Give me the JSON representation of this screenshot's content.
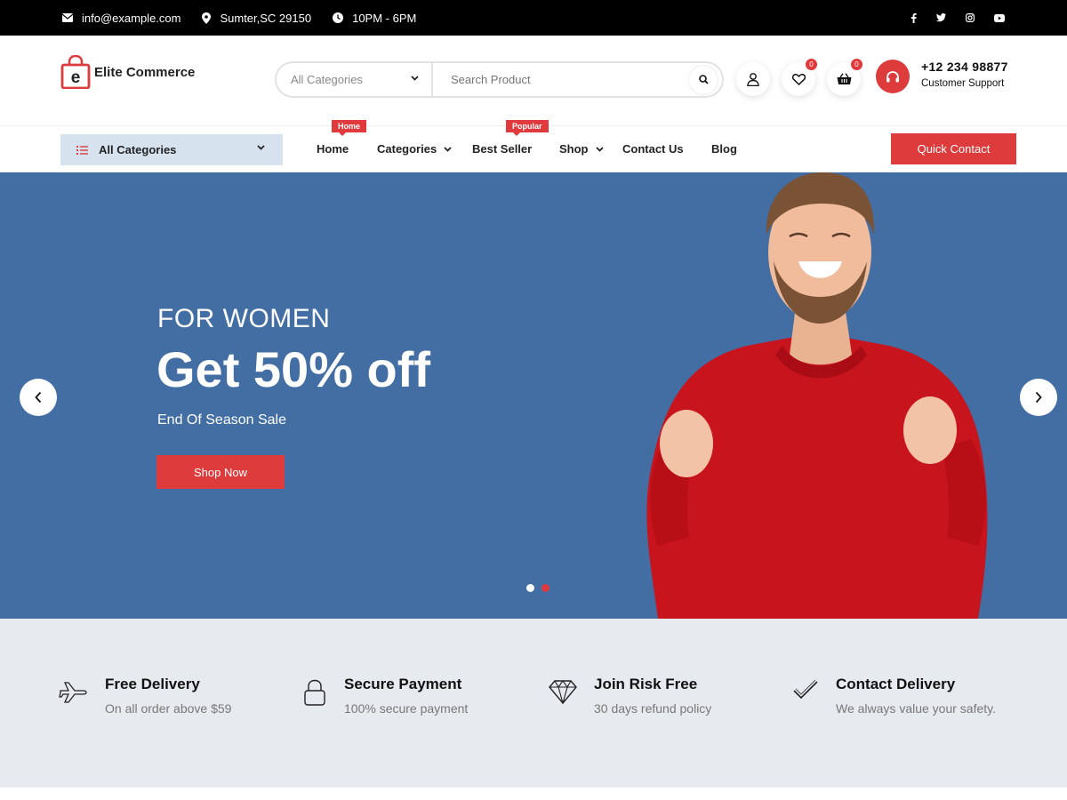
{
  "topbar": {
    "email": "info@example.com",
    "location": "Sumter,SC 29150",
    "hours": "10PM - 6PM",
    "social": [
      "facebook-icon",
      "twitter-icon",
      "instagram-icon",
      "youtube-icon"
    ]
  },
  "brand": {
    "logo_letter": "e",
    "name": "Elite Commerce",
    "accent": "#dd3b3c"
  },
  "search": {
    "category_value": "All Categories",
    "placeholder": "Search Product"
  },
  "header_icons": {
    "wishlist_count": "0",
    "cart_count": "0"
  },
  "support": {
    "phone": "+12 234 98877",
    "label": "Customer Support"
  },
  "nav": {
    "all_categories": "All Categories",
    "items": [
      {
        "label": "Home",
        "tag": "Home"
      },
      {
        "label": "Categories"
      },
      {
        "label": "Best Seller",
        "tag": "Popular"
      },
      {
        "label": "Shop"
      },
      {
        "label": "Contact Us"
      },
      {
        "label": "Blog"
      }
    ],
    "quick_contact": "Quick Contact"
  },
  "hero": {
    "subtitle": "FOR WOMEN",
    "title": "Get 50% off",
    "description": "End Of Season Sale",
    "button": "Shop Now",
    "background": "#426ea3",
    "slides": 2,
    "active_slide": 1
  },
  "features": [
    {
      "icon": "plane-icon",
      "title": "Free Delivery",
      "desc": "On all order above $59"
    },
    {
      "icon": "lock-icon",
      "title": "Secure Payment",
      "desc": "100% secure payment"
    },
    {
      "icon": "diamond-icon",
      "title": "Join Risk Free",
      "desc": "30 days refund policy"
    },
    {
      "icon": "checkmark-icon",
      "title": "Contact Delivery",
      "desc": "We always value your safety."
    }
  ]
}
